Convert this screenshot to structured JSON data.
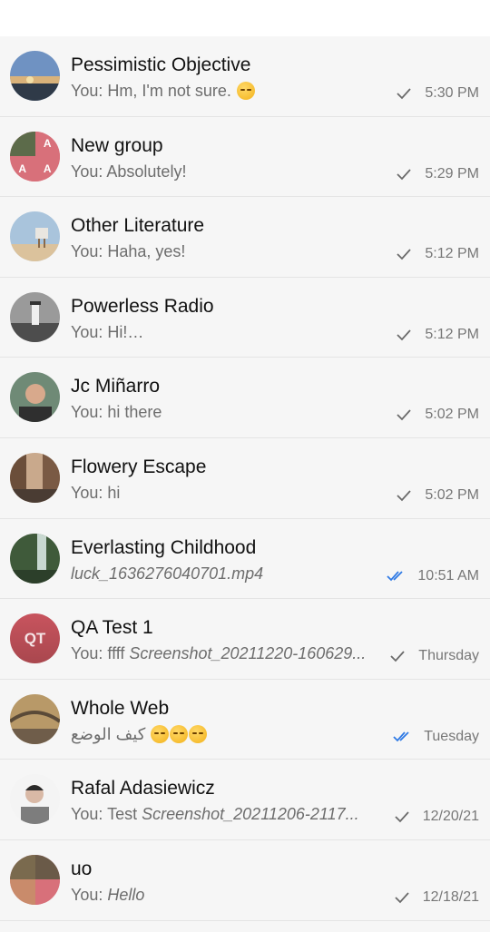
{
  "chats": [
    {
      "name": "Pessimistic Objective",
      "prefix": "You:",
      "message": " Hm, I'm not sure. ",
      "italic": "",
      "emoji": 1,
      "status": "sent",
      "time": "5:30 PM"
    },
    {
      "name": "New group",
      "prefix": "You:",
      "message": " Absolutely!",
      "italic": "",
      "emoji": 0,
      "status": "sent",
      "time": "5:29 PM",
      "avatar_letters": [
        "A",
        "A",
        "A"
      ]
    },
    {
      "name": "Other Literature",
      "prefix": "You:",
      "message": " Haha, yes!",
      "italic": "",
      "emoji": 0,
      "status": "sent",
      "time": "5:12 PM"
    },
    {
      "name": "Powerless Radio",
      "prefix": "You:",
      "message": " Hi!…",
      "italic": "",
      "emoji": 0,
      "status": "sent",
      "time": "5:12 PM"
    },
    {
      "name": "Jc Miñarro",
      "prefix": "You:",
      "message": " hi there",
      "italic": "",
      "emoji": 0,
      "status": "sent",
      "time": "5:02 PM"
    },
    {
      "name": "Flowery Escape",
      "prefix": "You:",
      "message": " hi",
      "italic": "",
      "emoji": 0,
      "status": "sent",
      "time": "5:02 PM"
    },
    {
      "name": "Everlasting Childhood",
      "prefix": "",
      "message": "",
      "italic": "luck_1636276040701.mp4",
      "emoji": 0,
      "status": "read",
      "time": "10:51 AM"
    },
    {
      "name": "QA Test 1",
      "prefix": "You:",
      "message": " ffff ",
      "italic": "Screenshot_20211220-160629...",
      "emoji": 0,
      "status": "sent",
      "time": "Thursday",
      "avatar_initials": "QT"
    },
    {
      "name": "Whole Web",
      "prefix": "",
      "message": "كيف الوضع ",
      "italic": "",
      "emoji": 3,
      "status": "read",
      "time": "Tuesday"
    },
    {
      "name": "Rafal Adasiewicz",
      "prefix": "You:",
      "message": " Test ",
      "italic": "Screenshot_20211206-2117...",
      "emoji": 0,
      "status": "sent",
      "time": "12/20/21"
    },
    {
      "name": "uo",
      "prefix": "You:",
      "message": " ",
      "italic": "Hello",
      "emoji": 0,
      "status": "sent",
      "time": "12/18/21"
    }
  ],
  "colors": {
    "sent_check": "#6a6a6a",
    "read_check": "#2f7ae5",
    "qa_avatar": "#c0505a",
    "group_avatar": "#d8707a"
  }
}
